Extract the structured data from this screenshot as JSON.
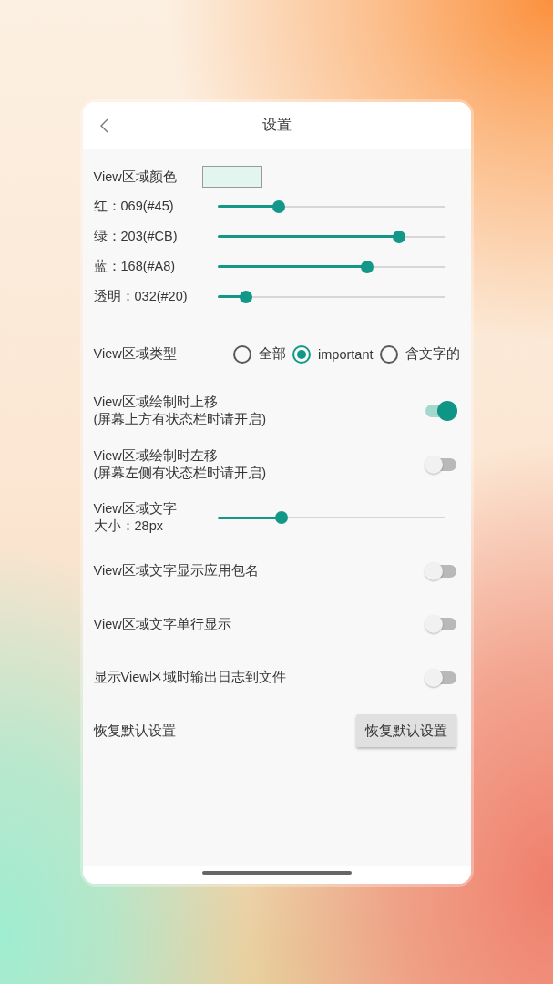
{
  "header": {
    "title": "设置"
  },
  "color_setting": {
    "label": "View区域颜色",
    "color": "#e3f5ef"
  },
  "channels": [
    {
      "label": "红：069(#45)",
      "level": 0.27
    },
    {
      "label": "绿：203(#CB)",
      "level": 0.796
    },
    {
      "label": "蓝：168(#A8)",
      "level": 0.659
    },
    {
      "label": "透明：032(#20)",
      "level": 0.125
    }
  ],
  "area_type": {
    "label": "View区域类型",
    "options": [
      {
        "label": "全部",
        "selected": false
      },
      {
        "label": "important",
        "selected": true
      },
      {
        "label": "含文字的",
        "selected": false
      }
    ]
  },
  "settings": [
    {
      "kind": "toggle",
      "label": "View区域绘制时上移",
      "note": "(屏幕上方有状态栏时请开启)",
      "on": true
    },
    {
      "kind": "toggle",
      "label": "View区域绘制时左移",
      "note": "(屏幕左侧有状态栏时请开启)",
      "on": false
    },
    {
      "kind": "slider",
      "label": "View区域文字",
      "reading": "大小：28px",
      "level": 0.28
    },
    {
      "kind": "toggle",
      "label": "View区域文字显示应用包名",
      "on": false
    },
    {
      "kind": "toggle",
      "label": "View区域文字单行显示",
      "on": false
    },
    {
      "kind": "toggle",
      "label": "显示View区域时输出日志到文件",
      "on": false
    },
    {
      "kind": "button",
      "label": "恢复默认设置",
      "button": "恢复默认设置"
    }
  ]
}
